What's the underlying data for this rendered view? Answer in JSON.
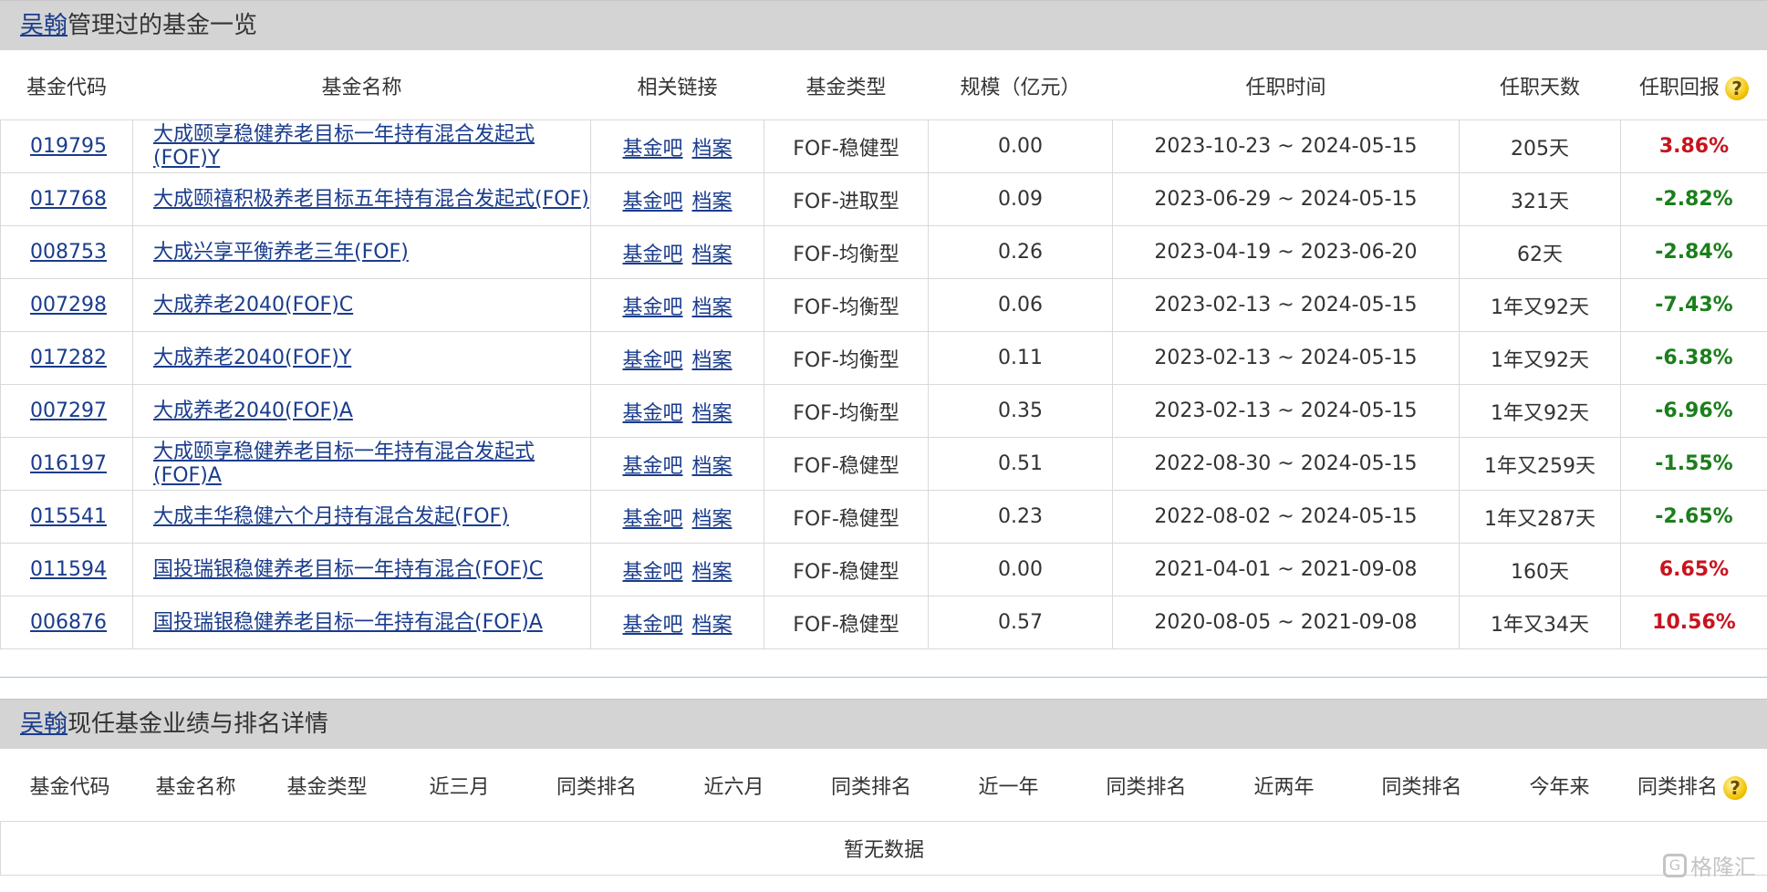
{
  "section1": {
    "manager_name": "吴翰",
    "title_suffix": "管理过的基金一览",
    "columns": [
      "基金代码",
      "基金名称",
      "相关链接",
      "基金类型",
      "规模（亿元）",
      "任职时间",
      "任职天数",
      "任职回报"
    ],
    "link_labels": [
      "基金吧",
      "档案"
    ],
    "rows": [
      {
        "code": "019795",
        "name": "大成颐享稳健养老目标一年持有混合发起式(FOF)Y",
        "type": "FOF-稳健型",
        "scale": "0.00",
        "period": "2023-10-23 ~ 2024-05-15",
        "days": "205天",
        "return": "3.86%",
        "sign": "pos"
      },
      {
        "code": "017768",
        "name": "大成颐禧积极养老目标五年持有混合发起式(FOF)",
        "type": "FOF-进取型",
        "scale": "0.09",
        "period": "2023-06-29 ~ 2024-05-15",
        "days": "321天",
        "return": "-2.82%",
        "sign": "neg"
      },
      {
        "code": "008753",
        "name": "大成兴享平衡养老三年(FOF)",
        "type": "FOF-均衡型",
        "scale": "0.26",
        "period": "2023-04-19 ~ 2023-06-20",
        "days": "62天",
        "return": "-2.84%",
        "sign": "neg"
      },
      {
        "code": "007298",
        "name": "大成养老2040(FOF)C",
        "type": "FOF-均衡型",
        "scale": "0.06",
        "period": "2023-02-13 ~ 2024-05-15",
        "days": "1年又92天",
        "return": "-7.43%",
        "sign": "neg"
      },
      {
        "code": "017282",
        "name": "大成养老2040(FOF)Y",
        "type": "FOF-均衡型",
        "scale": "0.11",
        "period": "2023-02-13 ~ 2024-05-15",
        "days": "1年又92天",
        "return": "-6.38%",
        "sign": "neg"
      },
      {
        "code": "007297",
        "name": "大成养老2040(FOF)A",
        "type": "FOF-均衡型",
        "scale": "0.35",
        "period": "2023-02-13 ~ 2024-05-15",
        "days": "1年又92天",
        "return": "-6.96%",
        "sign": "neg"
      },
      {
        "code": "016197",
        "name": "大成颐享稳健养老目标一年持有混合发起式(FOF)A",
        "type": "FOF-稳健型",
        "scale": "0.51",
        "period": "2022-08-30 ~ 2024-05-15",
        "days": "1年又259天",
        "return": "-1.55%",
        "sign": "neg"
      },
      {
        "code": "015541",
        "name": "大成丰华稳健六个月持有混合发起(FOF)",
        "type": "FOF-稳健型",
        "scale": "0.23",
        "period": "2022-08-02 ~ 2024-05-15",
        "days": "1年又287天",
        "return": "-2.65%",
        "sign": "neg"
      },
      {
        "code": "011594",
        "name": "国投瑞银稳健养老目标一年持有混合(FOF)C",
        "type": "FOF-稳健型",
        "scale": "0.00",
        "period": "2021-04-01 ~ 2021-09-08",
        "days": "160天",
        "return": "6.65%",
        "sign": "pos"
      },
      {
        "code": "006876",
        "name": "国投瑞银稳健养老目标一年持有混合(FOF)A",
        "type": "FOF-稳健型",
        "scale": "0.57",
        "period": "2020-08-05 ~ 2021-09-08",
        "days": "1年又34天",
        "return": "10.56%",
        "sign": "pos"
      }
    ]
  },
  "section2": {
    "manager_name": "吴翰",
    "title_suffix": "现任基金业绩与排名详情",
    "columns": [
      "基金代码",
      "基金名称",
      "基金类型",
      "近三月",
      "同类排名",
      "近六月",
      "同类排名",
      "近一年",
      "同类排名",
      "近两年",
      "同类排名",
      "今年来",
      "同类排名"
    ],
    "empty_text": "暂无数据"
  },
  "help_icon_glyph": "?",
  "watermark": {
    "icon_glyph": "G",
    "text": "格隆汇"
  },
  "colors": {
    "positive": "#c8141e",
    "negative": "#1b7f1b",
    "link": "#1a3c8c",
    "header_bg": "#d4d4d4"
  }
}
